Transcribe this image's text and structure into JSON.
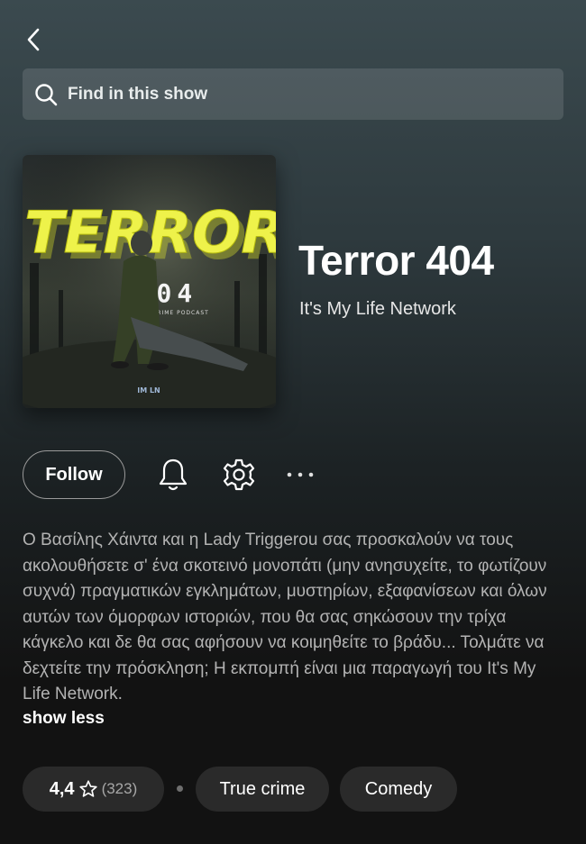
{
  "nav": {
    "back_icon": "chevron-left-icon"
  },
  "search": {
    "placeholder": "Find in this show",
    "icon": "search-icon"
  },
  "show": {
    "cover_art": {
      "wordmark": "TERROR",
      "number": "404",
      "tagline": "A TRUE CRIME PODCAST",
      "logo": "IM LN"
    },
    "title": "Terror 404",
    "publisher": "It's My Life Network"
  },
  "actions": {
    "follow_label": "Follow",
    "notify_icon": "bell-icon",
    "settings_icon": "gear-icon",
    "more_icon": "more-options-icon"
  },
  "description": {
    "text": "Ο Βασίλης Χάιντα και η Lady Triggerou σας προσκαλούν να τους ακολουθήσετε σ' ένα σκοτεινό μονοπάτι (μην ανησυχείτε, το φωτίζουν συχνά) πραγματικών εγκλημάτων, μυστηρίων, εξαφανίσεων και όλων αυτών των όμορφων ιστοριών, που θα σας σηκώσουν την τρίχα κάγκελο και δε θα σας αφήσουν να κοιμηθείτε το βράδυ... Τολμάτε να δεχτείτε την πρόσκληση; Η εκπομπή είναι μια παραγωγή του It's My Life Network.",
    "toggle_label": "show less"
  },
  "rating": {
    "value": "4,4",
    "count": "(323)",
    "icon": "star-outline-icon"
  },
  "tags": [
    "True crime",
    "Comedy"
  ],
  "colors": {
    "background_top": "#3b4a4f",
    "background_bottom": "#121212",
    "pill": "#2a2a2a",
    "accent_yellow": "#e8f02a"
  }
}
